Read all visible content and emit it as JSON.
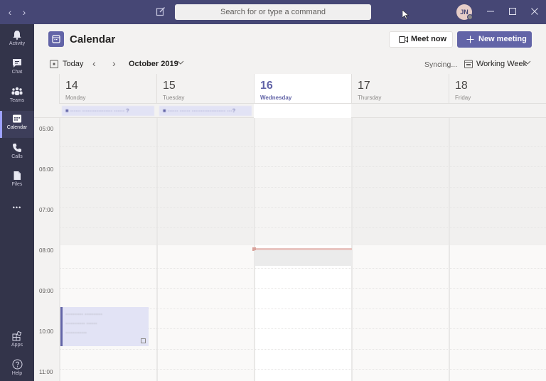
{
  "titlebar": {
    "search_placeholder": "Search for or type a command",
    "avatar_initials": "JN",
    "back_label": "‹",
    "forward_label": "›"
  },
  "rail": {
    "items": [
      {
        "id": "activity",
        "label": "Activity",
        "icon": "bell-icon"
      },
      {
        "id": "chat",
        "label": "Chat",
        "icon": "chat-icon"
      },
      {
        "id": "teams",
        "label": "Teams",
        "icon": "teams-icon"
      },
      {
        "id": "calendar",
        "label": "Calendar",
        "icon": "calendar-icon",
        "active": true
      },
      {
        "id": "calls",
        "label": "Calls",
        "icon": "phone-icon"
      },
      {
        "id": "files",
        "label": "Files",
        "icon": "file-icon"
      },
      {
        "id": "more",
        "label": "•••",
        "icon": "more-icon"
      },
      {
        "id": "apps",
        "label": "Apps",
        "icon": "apps-icon"
      },
      {
        "id": "help",
        "label": "Help",
        "icon": "help-icon"
      }
    ]
  },
  "header": {
    "title": "Calendar",
    "meet_now": "Meet now",
    "new_meeting": "New meeting"
  },
  "toolbar": {
    "today": "Today",
    "prev": "‹",
    "next": "›",
    "month": "October 2019",
    "sync_status": "Syncing...",
    "view": "Working Week"
  },
  "days": [
    {
      "num": "14",
      "name": "Monday"
    },
    {
      "num": "15",
      "name": "Tuesday"
    },
    {
      "num": "16",
      "name": "Wednesday",
      "today": true
    },
    {
      "num": "17",
      "name": "Thursday"
    },
    {
      "num": "18",
      "name": "Friday"
    }
  ],
  "all_day_events": [
    {
      "day": "Monday",
      "text": "■ ······ ················· ······ ?"
    },
    {
      "day": "Tuesday",
      "text": "■ ······ ······ ··················· ···?"
    }
  ],
  "times": [
    "05:00",
    "06:00",
    "07:00",
    "08:00",
    "09:00",
    "10:00",
    "11:00"
  ],
  "events": [
    {
      "day": "Monday",
      "lines": [
        "·········· ··········",
        "··········· ······",
        "············"
      ]
    }
  ],
  "colors": {
    "brand": "#6264a7",
    "titlebar": "#464775",
    "rail": "#33344a",
    "event_bg": "#e2e3f5"
  }
}
